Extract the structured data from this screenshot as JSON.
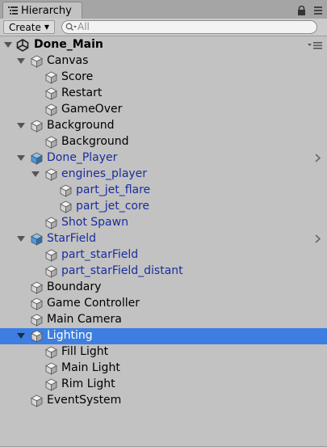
{
  "tab": {
    "title": "Hierarchy"
  },
  "toolbar": {
    "create_label": "Create",
    "search_placeholder": "All"
  },
  "scene": {
    "name": "Done_Main"
  },
  "rows": [
    {
      "label": "Canvas",
      "depth": 1,
      "expanded": true,
      "prefab": false,
      "selected": false
    },
    {
      "label": "Score",
      "depth": 2,
      "prefab": false,
      "selected": false
    },
    {
      "label": "Restart",
      "depth": 2,
      "prefab": false,
      "selected": false
    },
    {
      "label": "GameOver",
      "depth": 2,
      "prefab": false,
      "selected": false
    },
    {
      "label": "Background",
      "depth": 1,
      "expanded": true,
      "prefab": false,
      "selected": false
    },
    {
      "label": "Background",
      "depth": 2,
      "prefab": false,
      "selected": false
    },
    {
      "label": "Done_Player",
      "depth": 1,
      "expanded": true,
      "prefab": true,
      "prefab_root": true,
      "selected": false
    },
    {
      "label": "engines_player",
      "depth": 2,
      "expanded": true,
      "prefab": true,
      "selected": false
    },
    {
      "label": "part_jet_flare",
      "depth": 3,
      "prefab": true,
      "selected": false
    },
    {
      "label": "part_jet_core",
      "depth": 3,
      "prefab": true,
      "selected": false
    },
    {
      "label": "Shot Spawn",
      "depth": 2,
      "prefab": true,
      "selected": false
    },
    {
      "label": "StarField",
      "depth": 1,
      "expanded": true,
      "prefab": true,
      "prefab_root": true,
      "selected": false
    },
    {
      "label": "part_starField",
      "depth": 2,
      "prefab": true,
      "selected": false
    },
    {
      "label": "part_starField_distant",
      "depth": 2,
      "prefab": true,
      "selected": false
    },
    {
      "label": "Boundary",
      "depth": 1,
      "prefab": false,
      "selected": false
    },
    {
      "label": "Game Controller",
      "depth": 1,
      "prefab": false,
      "selected": false
    },
    {
      "label": "Main Camera",
      "depth": 1,
      "prefab": false,
      "selected": false
    },
    {
      "label": "Lighting",
      "depth": 1,
      "expanded": true,
      "prefab": false,
      "selected": true
    },
    {
      "label": "Fill Light",
      "depth": 2,
      "prefab": false,
      "selected": false
    },
    {
      "label": "Main Light",
      "depth": 2,
      "prefab": false,
      "selected": false
    },
    {
      "label": "Rim Light",
      "depth": 2,
      "prefab": false,
      "selected": false
    },
    {
      "label": "EventSystem",
      "depth": 1,
      "prefab": false,
      "selected": false
    }
  ],
  "colors": {
    "panel_bg": "#c2c2c2",
    "selection": "#3d7ee0",
    "prefab_text": "#1a2d9c",
    "prefab_cube": "#4a9be0"
  },
  "icons": {
    "gameobject": "gameobject-cube-icon",
    "prefab": "prefab-cube-icon",
    "scene": "unity-scene-icon"
  }
}
